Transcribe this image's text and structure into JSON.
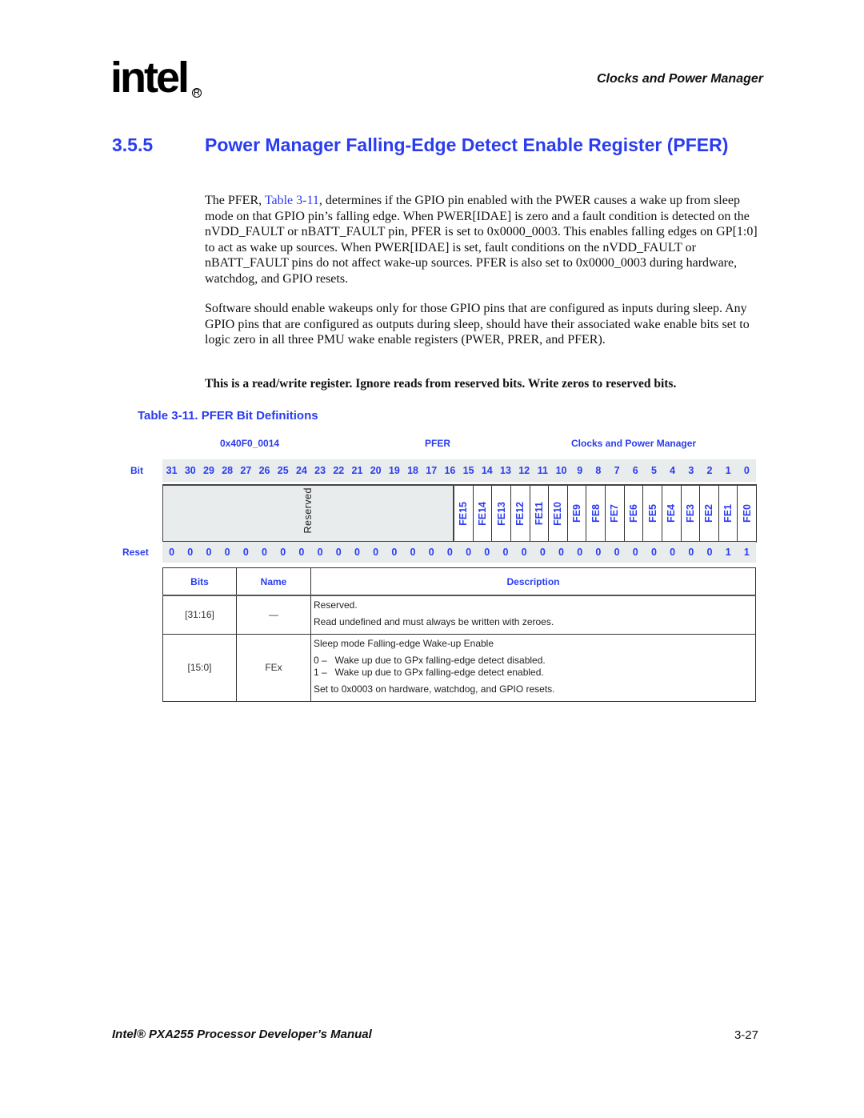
{
  "header": {
    "logo_text": "intel",
    "logo_registered": "R",
    "chapter": "Clocks and Power Manager"
  },
  "section": {
    "number": "3.5.5",
    "title": "Power Manager Falling-Edge Detect Enable Register (PFER)"
  },
  "paragraphs": {
    "p1_before_link": "The PFER, ",
    "p1_link": "Table 3-11",
    "p1_after_link": ", determines if the GPIO pin enabled with the PWER causes a wake up from sleep mode on that GPIO pin’s falling edge. When PWER[IDAE] is zero and a fault condition is detected on the nVDD_FAULT or nBATT_FAULT pin, PFER is set to 0x0000_0003. This enables falling edges on GP[1:0] to act as wake up sources. When PWER[IDAE] is set, fault conditions on the nVDD_FAULT or nBATT_FAULT pins do not affect wake-up sources. PFER is also set to 0x0000_0003 during hardware, watchdog, and GPIO resets.",
    "p2": "Software should enable wakeups only for those GPIO pins that are configured as inputs during sleep. Any GPIO pins that are configured as outputs during sleep, should have their associated wake enable bits set to logic zero in all three PMU wake enable registers (PWER, PRER, and PFER).",
    "note": "This is a read/write register. Ignore reads from reserved bits. Write zeros to reserved bits."
  },
  "table_caption": "Table 3-11. PFER Bit Definitions",
  "register": {
    "address": "0x40F0_0014",
    "name": "PFER",
    "unit": "Clocks and Power Manager",
    "bit_label": "Bit",
    "reset_label": "Reset",
    "bits": [
      "31",
      "30",
      "29",
      "28",
      "27",
      "26",
      "25",
      "24",
      "23",
      "22",
      "21",
      "20",
      "19",
      "18",
      "17",
      "16",
      "15",
      "14",
      "13",
      "12",
      "11",
      "10",
      "9",
      "8",
      "7",
      "6",
      "5",
      "4",
      "3",
      "2",
      "1",
      "0"
    ],
    "reset_values": [
      "0",
      "0",
      "0",
      "0",
      "0",
      "0",
      "0",
      "0",
      "0",
      "0",
      "0",
      "0",
      "0",
      "0",
      "0",
      "0",
      "0",
      "0",
      "0",
      "0",
      "0",
      "0",
      "0",
      "0",
      "0",
      "0",
      "0",
      "0",
      "0",
      "0",
      "1",
      "1"
    ],
    "reserved_label": "Reserved",
    "fields": [
      "FE15",
      "FE14",
      "FE13",
      "FE12",
      "FE11",
      "FE10",
      "FE9",
      "FE8",
      "FE7",
      "FE6",
      "FE5",
      "FE4",
      "FE3",
      "FE2",
      "FE1",
      "FE0"
    ]
  },
  "bit_table": {
    "headers": {
      "bits": "Bits",
      "name": "Name",
      "description": "Description"
    },
    "rows": [
      {
        "bits": "[31:16]",
        "name": "—",
        "desc": [
          "Reserved.",
          "Read undefined and must always be written with zeroes."
        ]
      },
      {
        "bits": "[15:0]",
        "name": "FEx",
        "desc": [
          "Sleep mode Falling-edge Wake-up Enable",
          "0 –   Wake up due to GPx falling-edge detect disabled.",
          "1 –   Wake up due to GPx falling-edge detect enabled.",
          "Set to 0x0003 on hardware, watchdog, and GPIO resets."
        ]
      }
    ]
  },
  "footer": {
    "manual": "Intel® PXA255 Processor Developer’s Manual",
    "page": "3-27"
  }
}
